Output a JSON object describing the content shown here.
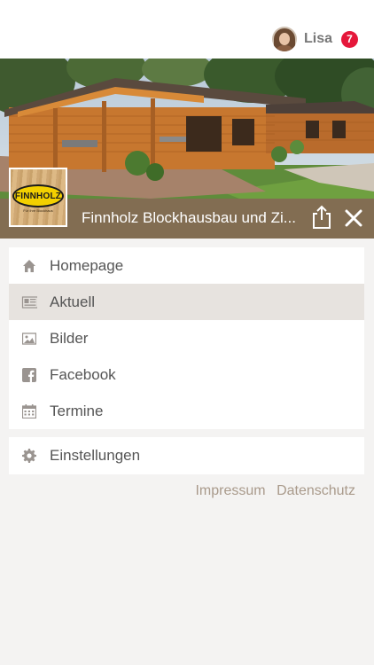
{
  "user": {
    "name": "Lisa",
    "notifications": "7"
  },
  "header": {
    "title": "Finnholz Blockhausbau und Zi...",
    "logo_text": "FINNHOLZ",
    "logo_sub": "Für Ihre Blockhaus"
  },
  "menu": [
    {
      "label": "Homepage",
      "icon": "home-icon"
    },
    {
      "label": "Aktuell",
      "icon": "news-icon",
      "active": true
    },
    {
      "label": "Bilder",
      "icon": "image-icon"
    },
    {
      "label": "Facebook",
      "icon": "facebook-icon"
    },
    {
      "label": "Termine",
      "icon": "calendar-icon"
    }
  ],
  "settings": {
    "label": "Einstellungen",
    "icon": "gear-icon"
  },
  "footer": {
    "impressum": "Impressum",
    "datenschutz": "Datenschutz"
  },
  "colors": {
    "accent_bar": "#826d52",
    "active_bg": "#e7e3df",
    "badge": "#e5173a",
    "footer_link": "#a99a8b"
  }
}
